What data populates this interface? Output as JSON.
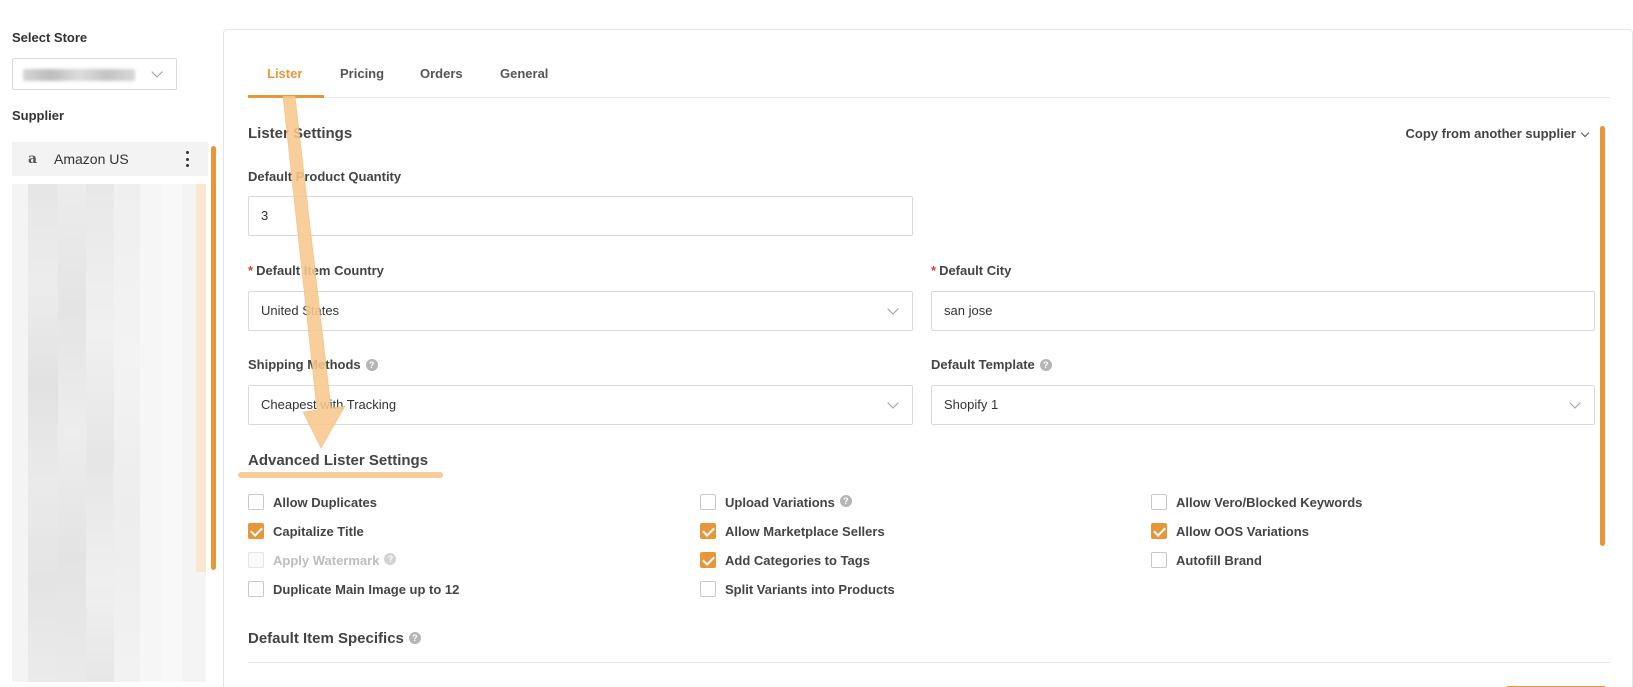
{
  "sidebar": {
    "select_store_label": "Select Store",
    "supplier_label": "Supplier",
    "supplier_item": "Amazon US",
    "amazon_glyph": "a"
  },
  "tabs": [
    {
      "label": "Lister",
      "active": true
    },
    {
      "label": "Pricing",
      "active": false
    },
    {
      "label": "Orders",
      "active": false
    },
    {
      "label": "General",
      "active": false
    }
  ],
  "lister": {
    "title": "Lister Settings",
    "copy_link": "Copy from another supplier",
    "quantity": {
      "label": "Default Product Quantity",
      "value": "3"
    },
    "country": {
      "label": "Default Item Country",
      "value": "United States",
      "required": true
    },
    "city": {
      "label": "Default City",
      "value": "san jose",
      "required": true
    },
    "shipping": {
      "label": "Shipping Methods",
      "value": "Cheapest with Tracking"
    },
    "template": {
      "label": "Default Template",
      "value": "Shopify 1"
    }
  },
  "advanced": {
    "title": "Advanced Lister Settings",
    "col1": [
      {
        "label": "Allow Duplicates",
        "checked": false
      },
      {
        "label": "Capitalize Title",
        "checked": true
      },
      {
        "label": "Apply Watermark",
        "checked": false,
        "disabled": true
      },
      {
        "label": "Duplicate Main Image up to 12",
        "checked": false
      }
    ],
    "col2": [
      {
        "label": "Upload Variations",
        "checked": false
      },
      {
        "label": "Allow Marketplace Sellers",
        "checked": true
      },
      {
        "label": "Add Categories to Tags",
        "checked": true
      },
      {
        "label": "Split Variants into Products",
        "checked": false
      }
    ],
    "col3": [
      {
        "label": "Allow Vero/Blocked Keywords",
        "checked": false
      },
      {
        "label": "Allow OOS Variations",
        "checked": true
      },
      {
        "label": "Autofill Brand",
        "checked": false
      }
    ]
  },
  "item_specifics": {
    "title": "Default Item Specifics"
  },
  "help_glyph": "?",
  "colors": {
    "accent": "#e8963a",
    "required": "#e53935",
    "annotation": "#f7c88c"
  }
}
